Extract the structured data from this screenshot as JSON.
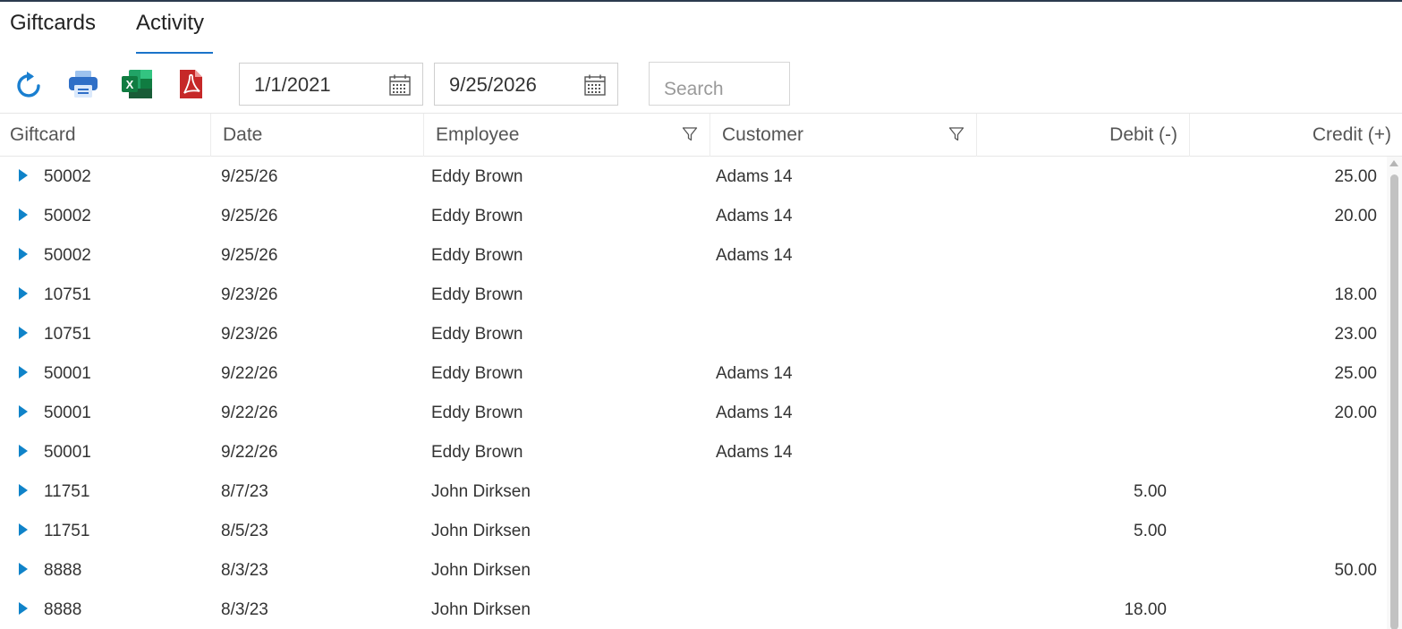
{
  "tabs": [
    {
      "label": "Giftcards"
    },
    {
      "label": "Activity"
    }
  ],
  "toolbar": {
    "refresh": "refresh-icon",
    "print": "printer-icon",
    "excel": "excel-icon",
    "pdf": "pdf-icon",
    "start_date": "1/1/2021",
    "end_date": "9/25/2026",
    "search_placeholder": "Search"
  },
  "table": {
    "columns": [
      "Giftcard",
      "Date",
      "Employee",
      "Customer",
      "Debit (-)",
      "Credit (+)"
    ],
    "rows": [
      {
        "giftcard": "50002",
        "date": "9/25/26",
        "employee": "Eddy Brown",
        "customer": "Adams 14",
        "debit": "",
        "credit": "25.00"
      },
      {
        "giftcard": "50002",
        "date": "9/25/26",
        "employee": "Eddy Brown",
        "customer": "Adams 14",
        "debit": "",
        "credit": "20.00"
      },
      {
        "giftcard": "50002",
        "date": "9/25/26",
        "employee": "Eddy Brown",
        "customer": "Adams 14",
        "debit": "",
        "credit": ""
      },
      {
        "giftcard": "10751",
        "date": "9/23/26",
        "employee": "Eddy Brown",
        "customer": "",
        "debit": "",
        "credit": "18.00"
      },
      {
        "giftcard": "10751",
        "date": "9/23/26",
        "employee": "Eddy Brown",
        "customer": "",
        "debit": "",
        "credit": "23.00"
      },
      {
        "giftcard": "50001",
        "date": "9/22/26",
        "employee": "Eddy Brown",
        "customer": "Adams 14",
        "debit": "",
        "credit": "25.00"
      },
      {
        "giftcard": "50001",
        "date": "9/22/26",
        "employee": "Eddy Brown",
        "customer": "Adams 14",
        "debit": "",
        "credit": "20.00"
      },
      {
        "giftcard": "50001",
        "date": "9/22/26",
        "employee": "Eddy Brown",
        "customer": "Adams 14",
        "debit": "",
        "credit": ""
      },
      {
        "giftcard": "11751",
        "date": "8/7/23",
        "employee": "John Dirksen",
        "customer": "",
        "debit": "5.00",
        "credit": ""
      },
      {
        "giftcard": "11751",
        "date": "8/5/23",
        "employee": "John Dirksen",
        "customer": "",
        "debit": "5.00",
        "credit": ""
      },
      {
        "giftcard": "8888",
        "date": "8/3/23",
        "employee": "John Dirksen",
        "customer": "",
        "debit": "",
        "credit": "50.00"
      },
      {
        "giftcard": "8888",
        "date": "8/3/23",
        "employee": "John Dirksen",
        "customer": "",
        "debit": "18.00",
        "credit": ""
      }
    ]
  },
  "colors": {
    "accent": "#1a73c9",
    "expander": "#0f83c9",
    "excel": "#1e7145",
    "pdf": "#c62828",
    "printer": "#2f6fc7"
  }
}
